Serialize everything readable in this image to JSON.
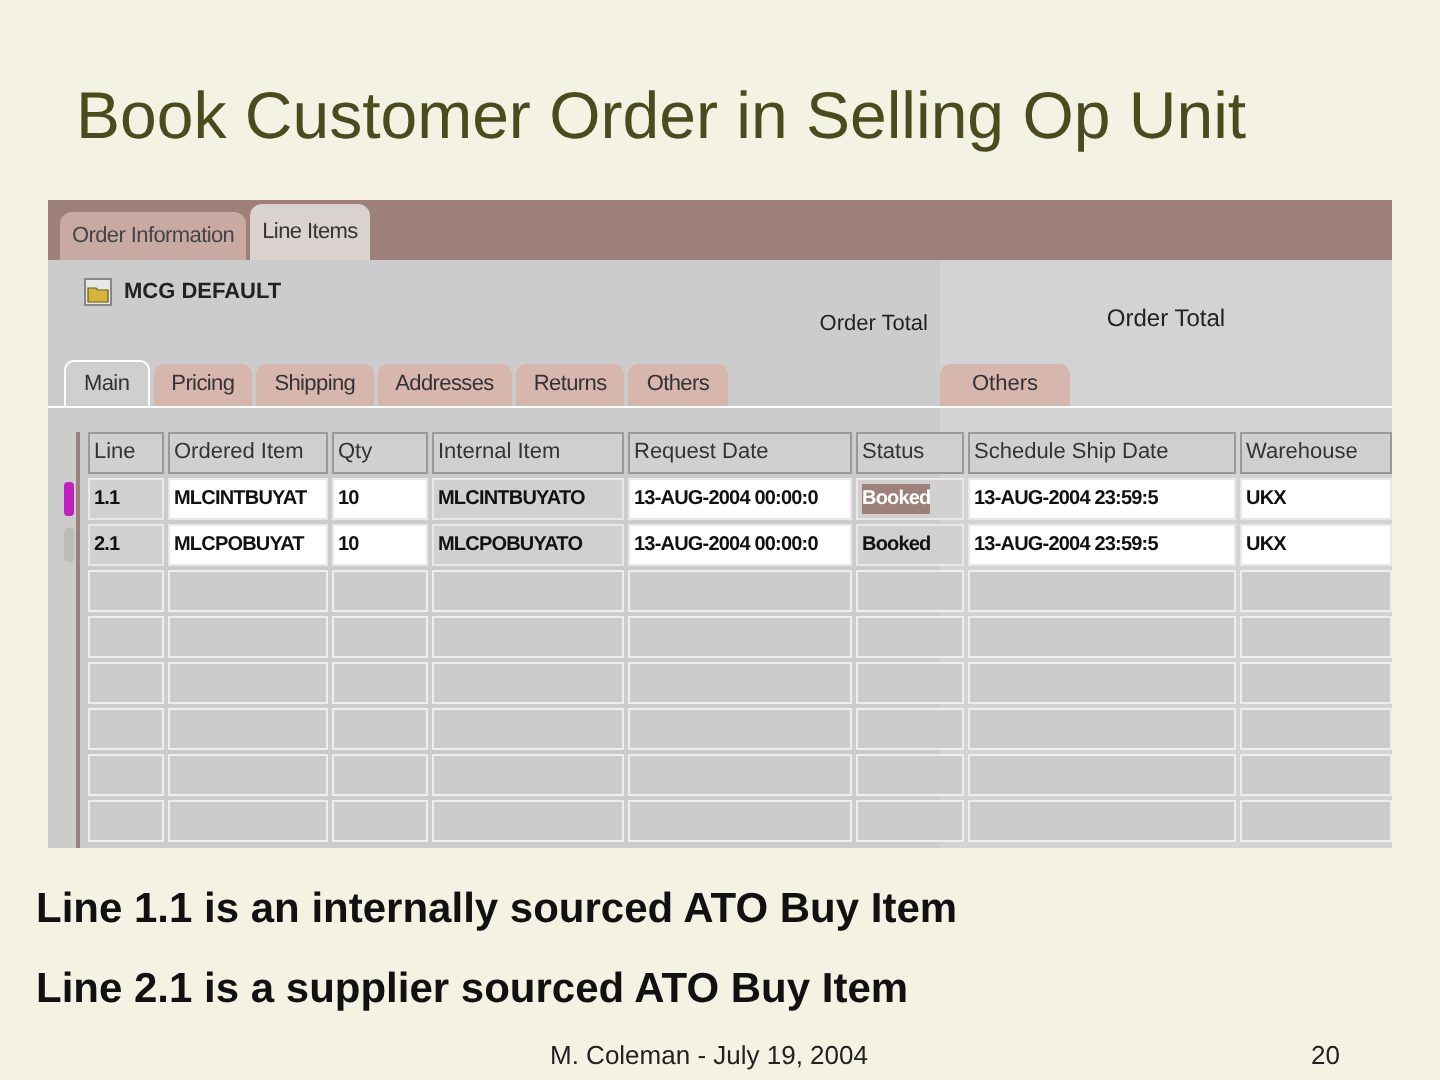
{
  "slide": {
    "title": "Book Customer Order in Selling Op Unit",
    "notes": [
      "Line 1.1 is an internally sourced ATO Buy Item",
      "Line 2.1 is a supplier sourced ATO Buy Item"
    ],
    "footer": "M. Coleman - July 19, 2004",
    "page_number": "20"
  },
  "form": {
    "top_tabs": [
      {
        "label": "Order Information",
        "selected": false
      },
      {
        "label": "Line Items",
        "selected": true
      }
    ],
    "header_title": "MCG DEFAULT",
    "order_total_labels": [
      "Order Total",
      "Order Total"
    ],
    "tabs": [
      {
        "label": "Main",
        "selected": true
      },
      {
        "label": "Pricing",
        "selected": false
      },
      {
        "label": "Shipping",
        "selected": false
      },
      {
        "label": "Addresses",
        "selected": false
      },
      {
        "label": "Returns",
        "selected": false
      },
      {
        "label": "Others",
        "selected": false
      }
    ],
    "right_tabs": [
      {
        "label": "Others",
        "selected": false
      }
    ],
    "table": {
      "columns": [
        "Line",
        "Ordered Item",
        "Qty",
        "Internal Item",
        "Request Date",
        "Status",
        "Schedule Ship Date",
        "Warehouse"
      ],
      "rows": [
        {
          "selected": true,
          "cells": [
            "1.1",
            "MLCINTBUYAT",
            "10",
            "MLCINTBUYATO",
            "13-AUG-2004 00:00:0",
            "Booked",
            "13-AUG-2004 23:59:5",
            "UKX"
          ]
        },
        {
          "selected": false,
          "cells": [
            "2.1",
            "MLCPOBUYAT",
            "10",
            "MLCPOBUYATO",
            "13-AUG-2004 00:00:0",
            "Booked",
            "13-AUG-2004 23:59:5",
            "UKX"
          ]
        }
      ]
    }
  }
}
